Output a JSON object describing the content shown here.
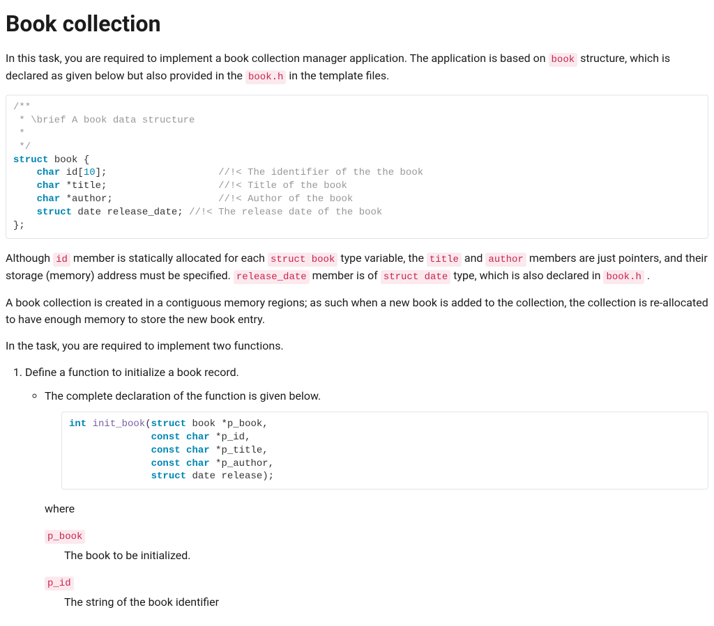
{
  "heading": "Book collection",
  "intro": {
    "t0": "In this task, you are required to implement a book collection manager application. The application is based on ",
    "c0": "book",
    "t1": " structure, which is declared as given below but also provided in the ",
    "c1": "book.h",
    "t2": " in the template files."
  },
  "code1": {
    "l0": "/**",
    "l1": " * \\brief A book data structure",
    "l2": " *",
    "l3": " */",
    "l4a": "struct",
    "l4b": " book {",
    "l5a": "    ",
    "l5b": "char",
    "l5c": " id[",
    "l5d": "10",
    "l5e": "];                   ",
    "l5f": "//!< The identifier of the the book",
    "l6a": "    ",
    "l6b": "char",
    "l6c": " *title;                   ",
    "l6d": "//!< Title of the book",
    "l7a": "    ",
    "l7b": "char",
    "l7c": " *author;                  ",
    "l7d": "//!< Author of the book",
    "l8a": "    ",
    "l8b": "struct",
    "l8c": " date release_date; ",
    "l8d": "//!< The release date of the book",
    "l9": "};"
  },
  "para2": {
    "t0": "Although ",
    "c0": "id",
    "t1": " member is statically allocated for each ",
    "c1": "struct book",
    "t2": " type variable, the ",
    "c2": "title",
    "t3": " and ",
    "c3": "author",
    "t4": " members are just pointers, and their storage (memory) address must be specified. ",
    "c4": "release_date",
    "t5": " member is of ",
    "c5": "struct date",
    "t6": " type, which is also declared in ",
    "c6": "book.h",
    "t7": " ."
  },
  "para3": "A book collection is created in a contiguous memory regions; as such when a new book is added to the collection, the collection is re-allocated to have enough memory to store the new book entry.",
  "para4": "In the task, you are required to implement two functions.",
  "task1": "Define a function to initialize a book record.",
  "task1_sub1": "The complete declaration of the function is given below.",
  "code2": {
    "l1a": "int",
    "l1b": " ",
    "l1c": "init_book",
    "l1d": "(",
    "l1e": "struct",
    "l1f": " book *p_book,",
    "l2a": "              ",
    "l2b": "const",
    "l2c": " ",
    "l2d": "char",
    "l2e": " *p_id,",
    "l3a": "              ",
    "l3b": "const",
    "l3c": " ",
    "l3d": "char",
    "l3e": " *p_title,",
    "l4a": "              ",
    "l4b": "const",
    "l4c": " ",
    "l4d": "char",
    "l4e": " *p_author,",
    "l5a": "              ",
    "l5b": "struct",
    "l5c": " date release);"
  },
  "where": "where",
  "params": {
    "p_book": {
      "name": "p_book",
      "desc": "The book to be initialized."
    },
    "p_id": {
      "name": "p_id",
      "desc": "The string of the book identifier"
    }
  }
}
